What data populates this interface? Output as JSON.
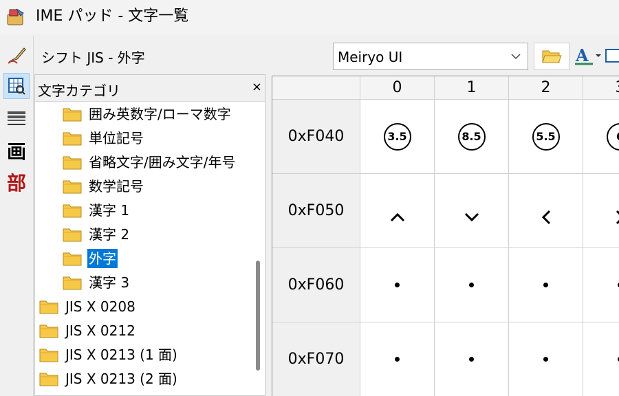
{
  "window": {
    "title": "IME パッド - 文字一覧"
  },
  "panel": {
    "title": "シフト JIS - 外字"
  },
  "font_selector": {
    "value": "Meiryo UI"
  },
  "category": {
    "title": "文字カテゴリ",
    "close": "×",
    "items": [
      {
        "label": "囲み英数字/ローマ数字",
        "selected": false
      },
      {
        "label": "単位記号",
        "selected": false
      },
      {
        "label": "省略文字/囲み文字/年号",
        "selected": false
      },
      {
        "label": "数学記号",
        "selected": false
      },
      {
        "label": "漢字 1",
        "selected": false
      },
      {
        "label": "漢字 2",
        "selected": false
      },
      {
        "label": "外字",
        "selected": true
      },
      {
        "label": "漢字 3",
        "selected": false
      },
      {
        "label": "JIS X 0208",
        "selected": false
      },
      {
        "label": "JIS X 0212",
        "selected": false
      },
      {
        "label": "JIS X 0213 (1 面)",
        "selected": false
      },
      {
        "label": "JIS X 0213 (2 面)",
        "selected": false
      }
    ]
  },
  "toolbar_icons": {
    "handwriting": "pen-icon",
    "char_list": "character-list-icon",
    "soft_keyboard": "keyboard-icon",
    "stroke_count": "画",
    "radical": "部"
  },
  "grid": {
    "columns": [
      "0",
      "1",
      "2",
      "3"
    ],
    "rows": [
      {
        "code": "0xF040",
        "chars": [
          "3.5",
          "8.5",
          "5.5",
          "6"
        ]
      },
      {
        "code": "0xF050",
        "chars": [
          "⌃",
          "⌄",
          "‹",
          "›"
        ]
      },
      {
        "code": "0xF060",
        "chars": [
          "•",
          "•",
          "•",
          "•"
        ]
      },
      {
        "code": "0xF070",
        "chars": [
          "•",
          "•",
          "•",
          "•"
        ]
      }
    ]
  },
  "colors": {
    "selection": "#0078d7",
    "active_tool": "#cce4f7",
    "folder": "#f7c948"
  }
}
